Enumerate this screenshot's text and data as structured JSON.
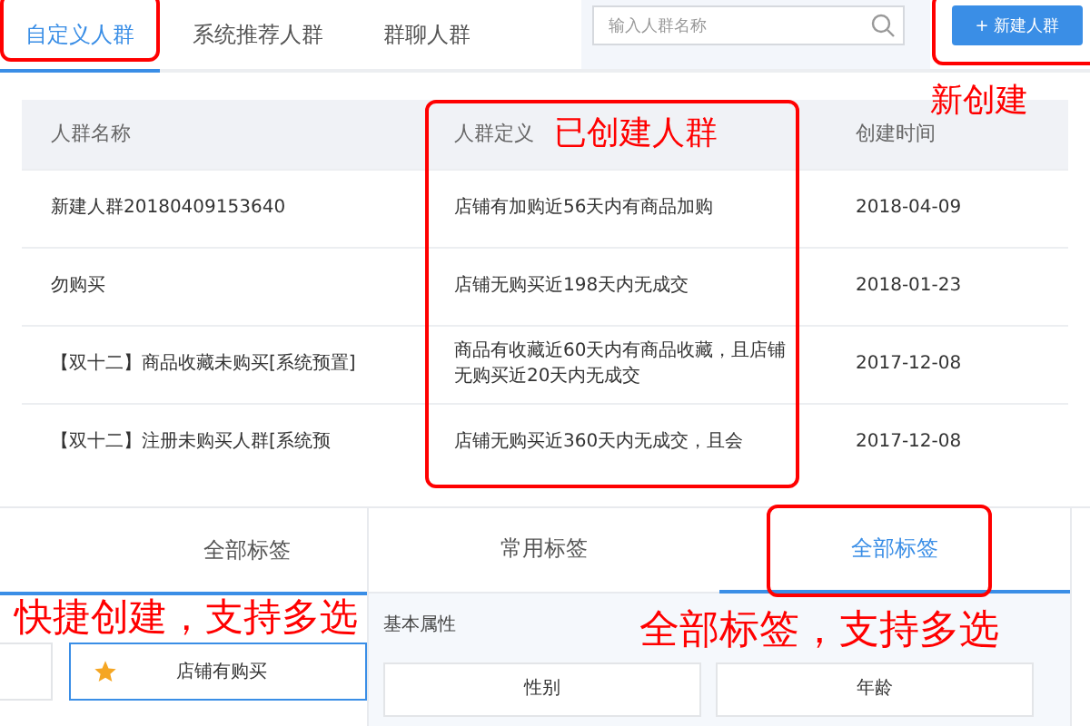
{
  "tabs": [
    {
      "label": "自定义人群",
      "selected": true
    },
    {
      "label": "系统推荐人群",
      "selected": false
    },
    {
      "label": "群聊人群",
      "selected": false
    }
  ],
  "search": {
    "placeholder": "输入人群名称"
  },
  "new_button": "+ 新建人群",
  "table": {
    "columns": [
      "人群名称",
      "人群定义",
      "创建时间"
    ],
    "rows": [
      {
        "name": "新建人群20180409153640",
        "definition": "店铺有加购近56天内有商品加购",
        "created": "2018-04-09"
      },
      {
        "name": "勿购买",
        "definition": "店铺无购买近198天内无成交",
        "created": "2018-01-23"
      },
      {
        "name": "【双十二】商品收藏未购买[系统预置]",
        "definition": "商品有收藏近60天内有商品收藏，且店铺无购买近20天内无成交",
        "created": "2017-12-08"
      },
      {
        "name": "【双十二】注册未购买人群[系统预",
        "definition": "店铺无购买近360天内无成交，且会",
        "created": "2017-12-08"
      }
    ]
  },
  "left_panel": {
    "tab": {
      "label": "全部标签",
      "selected": false
    },
    "quick_tags": [
      {
        "kind": "plain"
      },
      {
        "kind": "starred",
        "label": "店铺有购买"
      }
    ]
  },
  "right_panel": {
    "tabs": [
      {
        "label": "常用标签",
        "selected": false
      },
      {
        "label": "全部标签",
        "selected": true
      }
    ],
    "section": "基本属性",
    "cards": [
      "性别",
      "年龄"
    ]
  },
  "annotations": [
    {
      "text": "新创建"
    },
    {
      "text": "已创建人群"
    },
    {
      "text": "快捷创建，支持多选"
    },
    {
      "text": "全部标签，支持多选"
    }
  ]
}
